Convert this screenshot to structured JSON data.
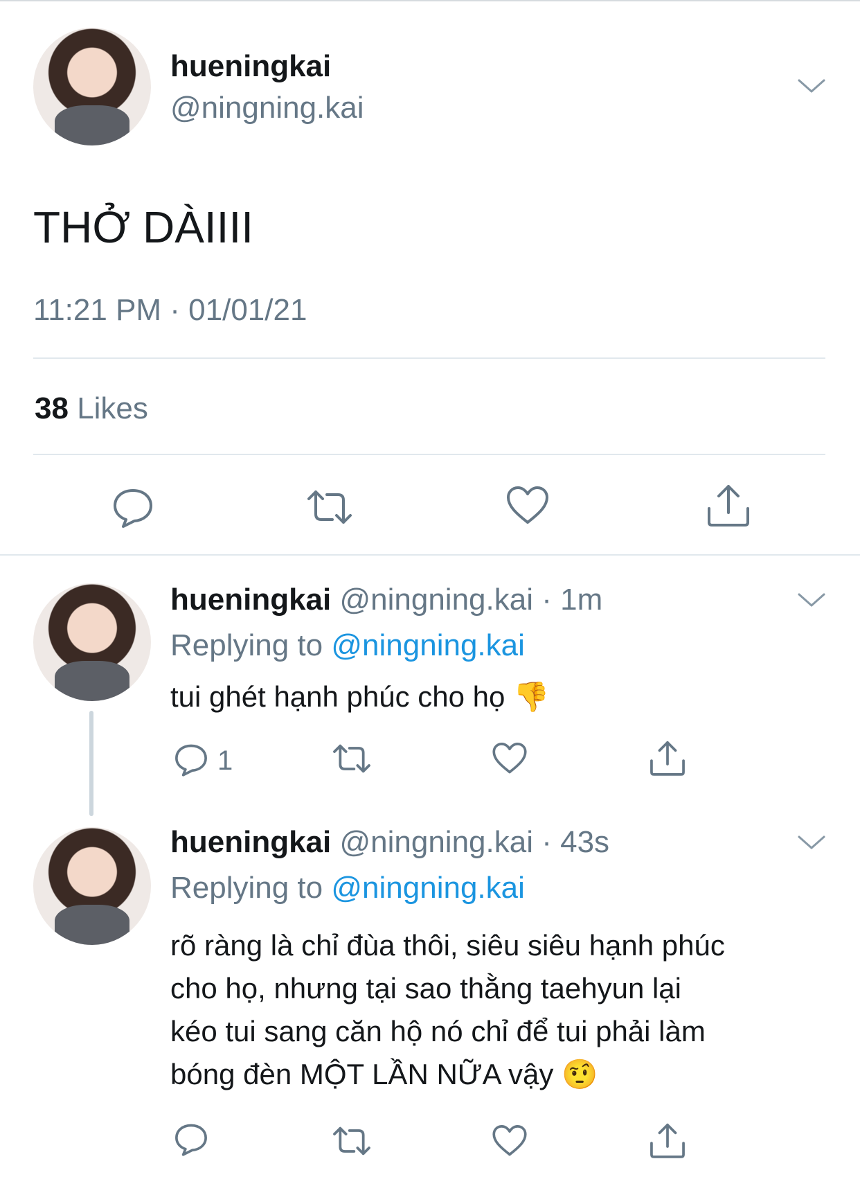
{
  "main_tweet": {
    "display_name": "hueningkai",
    "handle": "@ningning.kai",
    "text": "THỞ DÀIIII",
    "timestamp": "11:21 PM · 01/01/21",
    "likes_count": "38",
    "likes_label": "Likes"
  },
  "replies": [
    {
      "display_name": "hueningkai",
      "meta": "@ningning.kai · 1m",
      "replying_prefix": "Replying to",
      "replying_handle": "@ningning.kai",
      "text": "tui ghét hạnh phúc cho họ",
      "text_lines": [],
      "emoji": "👎",
      "reply_count": "1"
    },
    {
      "display_name": "hueningkai",
      "meta": "@ningning.kai · 43s",
      "replying_prefix": "Replying to",
      "replying_handle": "@ningning.kai",
      "text_lines": [
        "rõ ràng là chỉ đùa thôi, siêu siêu hạnh phúc",
        "cho họ, nhưng tại sao thằng taehyun lại",
        "kéo tui sang căn hộ nó chỉ để tui phải làm",
        "bóng đèn MỘT LẦN NỮA vậy"
      ],
      "emoji": "🤨",
      "reply_count": ""
    }
  ],
  "icons": {
    "reply": "speech-bubble-icon",
    "retweet": "retweet-arrows-icon",
    "like": "heart-icon",
    "share": "share-upload-icon",
    "more": "chevron-down-icon"
  },
  "colors": {
    "text": "#14171a",
    "secondary": "#657786",
    "link": "#1b95e0",
    "divider": "#e1e8ed",
    "thread_line": "#ccd6dd"
  }
}
